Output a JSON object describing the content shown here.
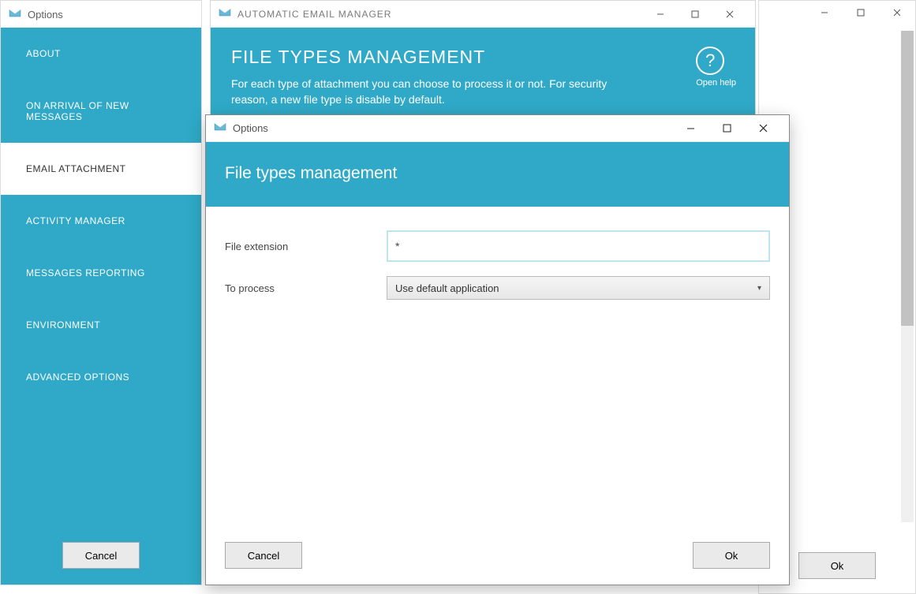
{
  "back_window": {
    "ok_label": "Ok"
  },
  "mid_window": {
    "title": "AUTOMATIC EMAIL MANAGER",
    "heading": "FILE TYPES MANAGEMENT",
    "description": "For each type of attachment you can choose to process it or not. For security reason, a new file type is disable by default.",
    "help_label": "Open help"
  },
  "left_window": {
    "title": "Options",
    "nav": {
      "about": "ABOUT",
      "arrival": "ON ARRIVAL OF NEW MESSAGES",
      "attachment": "EMAIL ATTACHMENT",
      "activity": "ACTIVITY MANAGER",
      "reporting": "MESSAGES REPORTING",
      "environment": "ENVIRONMENT",
      "advanced": "ADVANCED OPTIONS"
    },
    "cancel_label": "Cancel"
  },
  "front_window": {
    "title": "Options",
    "heading": "File types management",
    "file_extension_label": "File extension",
    "file_extension_value": "*",
    "to_process_label": "To process",
    "to_process_value": "Use default application",
    "cancel_label": "Cancel",
    "ok_label": "Ok"
  }
}
